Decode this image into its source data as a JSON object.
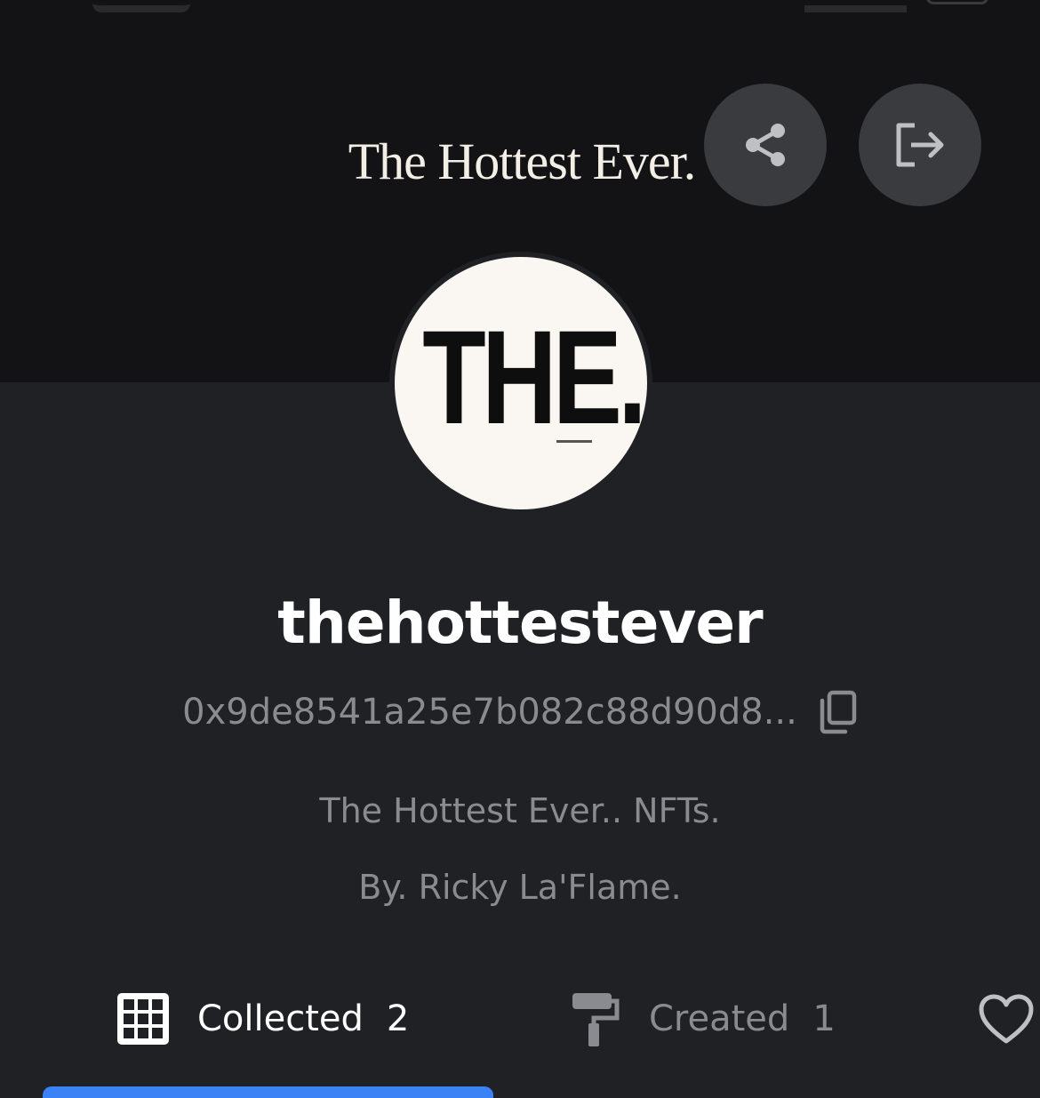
{
  "header": {
    "brand_title": "The Hottest Ever.",
    "share_icon": "share-icon",
    "logout_icon": "logout-icon"
  },
  "profile": {
    "avatar_text": "THE.",
    "username": "thehottestever",
    "wallet_address": "0x9de8541a25e7b082c88d90d8...",
    "copy_icon": "copy-icon",
    "bio_lines": [
      "The Hottest Ever.. NFTs.",
      "By. Ricky La'Flame."
    ]
  },
  "tabs": [
    {
      "label": "Collected",
      "count": "2",
      "icon": "grid-icon",
      "active": true
    },
    {
      "label": "Created",
      "count": "1",
      "icon": "paint-roller-icon",
      "active": false
    },
    {
      "label": "",
      "count": "",
      "icon": "heart-icon",
      "active": false
    }
  ],
  "colors": {
    "background": "#202125",
    "banner": "#131315",
    "button_bg": "#3a3b3f",
    "accent": "#3b82f6",
    "text_primary": "#ffffff",
    "text_secondary": "#8a8b90"
  }
}
